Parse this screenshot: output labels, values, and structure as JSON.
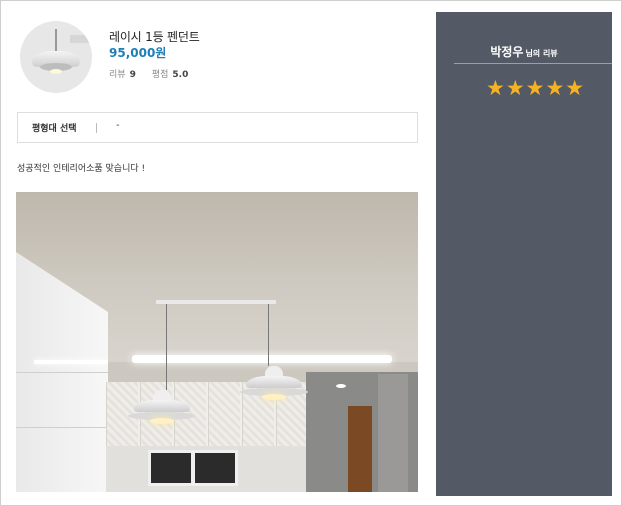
{
  "product": {
    "name": "레이시 1등 펜던트",
    "price": "95,000원",
    "review_label": "리뷰",
    "review_count": "9",
    "rating_label": "평점",
    "rating_value": "5.0"
  },
  "option": {
    "label": "평형대 선택",
    "value": "-"
  },
  "review": {
    "comment": "성공적인 인테리어소품 맞습니다 !",
    "rating_stars": 5,
    "star_symbol": "★★★★★"
  },
  "reviewer": {
    "name": "박정우",
    "suffix": "님의 리뷰"
  },
  "colors": {
    "panel_bg": "#545966",
    "price": "#1c7fb6",
    "star": "#f5b324"
  }
}
